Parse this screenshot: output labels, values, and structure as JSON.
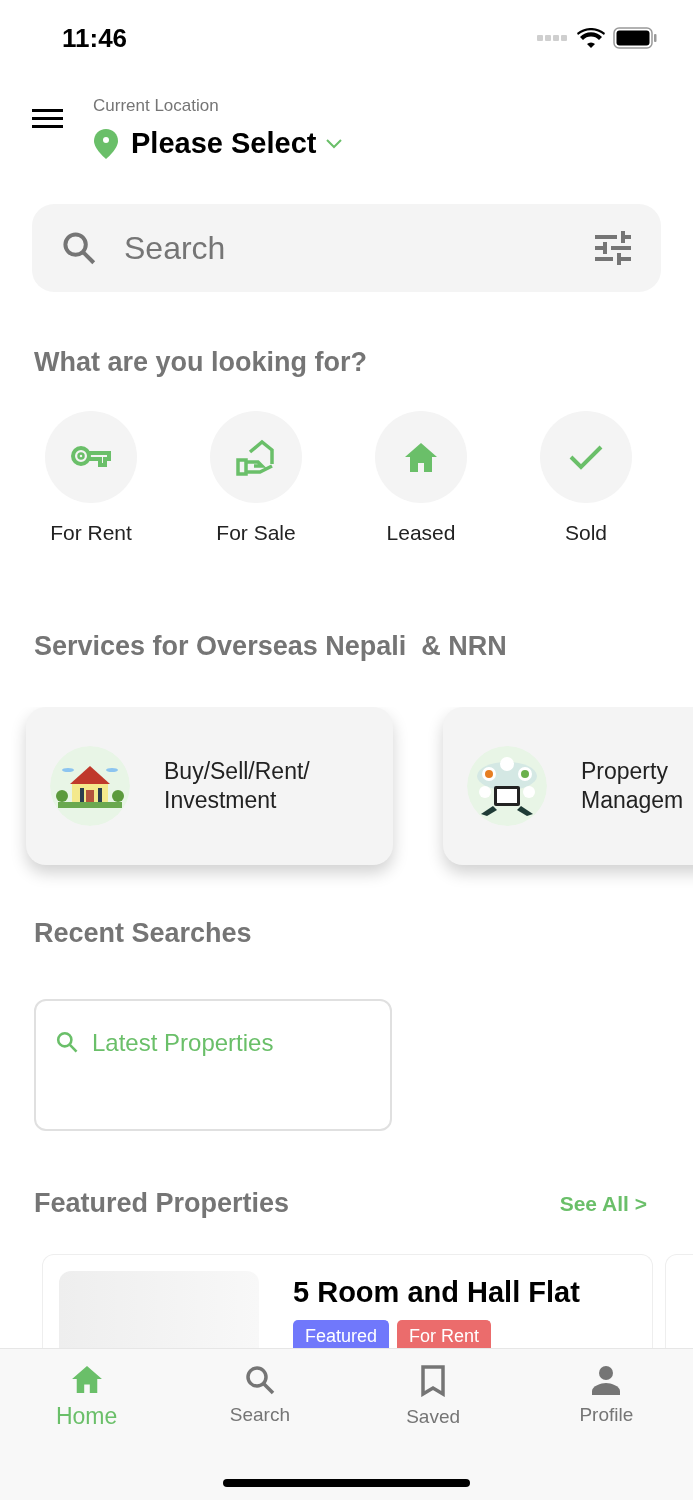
{
  "status_bar": {
    "time": "11:46"
  },
  "header": {
    "location_label": "Current Location",
    "location_value": "Please Select"
  },
  "search": {
    "placeholder": "Search"
  },
  "categories": {
    "title": "What are you looking for?",
    "items": [
      {
        "label": "For Rent",
        "kind": "key"
      },
      {
        "label": "For Sale",
        "kind": "sale"
      },
      {
        "label": "Leased",
        "kind": "home"
      },
      {
        "label": "Sold",
        "kind": "check"
      }
    ]
  },
  "services": {
    "title": "Services for Overseas Nepali  & NRN",
    "items": [
      {
        "label": "Buy/Sell/Rent/ Investment",
        "kind": "picture"
      },
      {
        "label": "Property Managem",
        "kind": "picture"
      }
    ]
  },
  "recent_searches": {
    "title": "Recent Searches",
    "items": [
      {
        "label": "Latest Properties"
      }
    ]
  },
  "featured": {
    "title": "Featured Properties",
    "see_all": "See All >",
    "items": [
      {
        "title": "5 Room and Hall Flat",
        "tags": [
          {
            "label": "Featured",
            "color": "#7078fb"
          },
          {
            "label": "For Rent",
            "color": "#eb6c6c"
          }
        ]
      }
    ]
  },
  "bottom_nav": [
    {
      "label": "Home",
      "kind": "home",
      "selected": true
    },
    {
      "label": "Search",
      "kind": "search",
      "selected": false
    },
    {
      "label": "Saved",
      "kind": "bookmark",
      "selected": false
    },
    {
      "label": "Profile",
      "kind": "person",
      "selected": false
    }
  ]
}
